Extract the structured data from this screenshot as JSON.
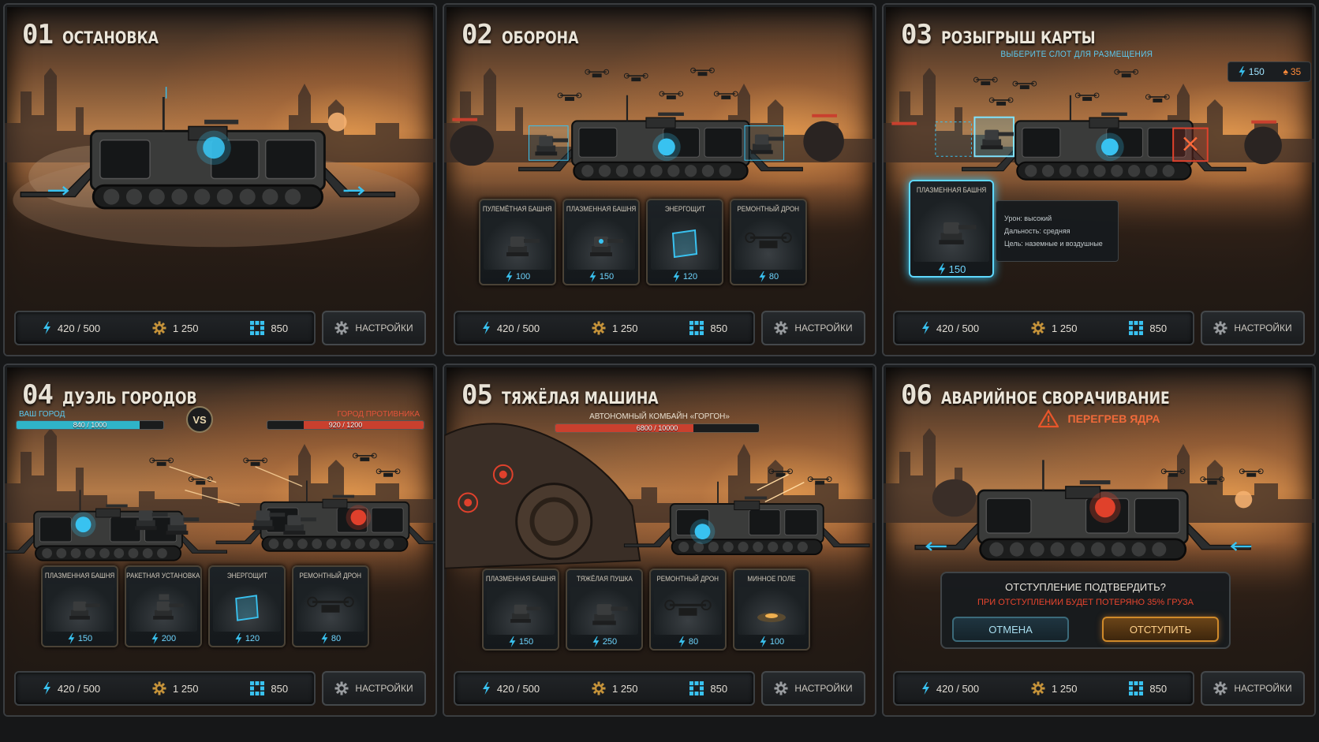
{
  "colors": {
    "energy": "#39c2f0",
    "accent_red": "#e0412c",
    "accent_orange": "#e88a2a",
    "ally": "#2fb4c8",
    "enemy": "#c9402e"
  },
  "resources": {
    "energy": "420 / 500",
    "scrap": "1 250",
    "chips": "850",
    "settings_label": "НАСТРОЙКИ"
  },
  "panels": [
    {
      "num": "01",
      "title": "ОСТАНОВКА"
    },
    {
      "num": "02",
      "title": "ОБОРОНА",
      "cards": [
        {
          "name": "ПУЛЕМЁТНАЯ БАШНЯ",
          "cost": "100",
          "icon": "turret-icon"
        },
        {
          "name": "ПЛАЗМЕННАЯ БАШНЯ",
          "cost": "150",
          "icon": "cannon-icon"
        },
        {
          "name": "ЭНЕРГОЩИТ",
          "cost": "120",
          "icon": "shield-icon"
        },
        {
          "name": "РЕМОНТНЫЙ ДРОН",
          "cost": "80",
          "icon": "drone-icon"
        }
      ]
    },
    {
      "num": "03",
      "title": "РОЗЫГРЫШ КАРТЫ",
      "subtitle": "ВЫБЕРИТЕ СЛОТ ДЛЯ РАЗМЕЩЕНИЯ",
      "counter_energy": "150",
      "counter_fire": "35",
      "selected_card": {
        "name": "ПЛАЗМЕННАЯ БАШНЯ",
        "cost": "150"
      },
      "tooltip": [
        "Урон: высокий",
        "Дальность: средняя",
        "Цель: наземные и воздушные"
      ]
    },
    {
      "num": "04",
      "title": "ДУЭЛЬ ГОРОДОВ",
      "ally_label": "ВАШ ГОРОД",
      "ally_hp": "840 / 1000",
      "ally_hp_fraction": 0.84,
      "vs": "VS",
      "enemy_label": "ГОРОД ПРОТИВНИКА",
      "enemy_hp": "920 / 1200",
      "enemy_hp_fraction": 0.767,
      "cards": [
        {
          "name": "ПЛАЗМЕННАЯ БАШНЯ",
          "cost": "150",
          "icon": "cannon-icon"
        },
        {
          "name": "РАКЕТНАЯ УСТАНОВКА",
          "cost": "200",
          "icon": "rocket-icon"
        },
        {
          "name": "ЭНЕРГОЩИТ",
          "cost": "120",
          "icon": "shield-icon"
        },
        {
          "name": "РЕМОНТНЫЙ ДРОН",
          "cost": "80",
          "icon": "drone-icon"
        }
      ]
    },
    {
      "num": "05",
      "title": "ТЯЖЁЛАЯ МАШИНА",
      "boss_name": "АВТОНОМНЫЙ КОМБАЙН «ГОРГОН»",
      "boss_hp": "6800 / 10000",
      "boss_hp_fraction": 0.68,
      "cards": [
        {
          "name": "ПЛАЗМЕННАЯ БАШНЯ",
          "cost": "150",
          "icon": "cannon-icon"
        },
        {
          "name": "ТЯЖЁЛАЯ ПУШКА",
          "cost": "250",
          "icon": "heavy-gun-icon"
        },
        {
          "name": "РЕМОНТНЫЙ ДРОН",
          "cost": "80",
          "icon": "drone-icon"
        },
        {
          "name": "МИННОЕ ПОЛЕ",
          "cost": "100",
          "icon": "mine-icon"
        }
      ]
    },
    {
      "num": "06",
      "title": "АВАРИЙНОЕ СВОРАЧИВАНИЕ",
      "warning": "ПЕРЕГРЕВ ЯДРА",
      "dialog_title": "ОТСТУПЛЕНИЕ ПОДТВЕРДИТЬ?",
      "dialog_text": "ПРИ ОТСТУПЛЕНИИ БУДЕТ ПОТЕРЯНО 35% ГРУЗА",
      "cancel_label": "ОТМЕНА",
      "confirm_label": "ОТСТУПИТЬ"
    }
  ]
}
